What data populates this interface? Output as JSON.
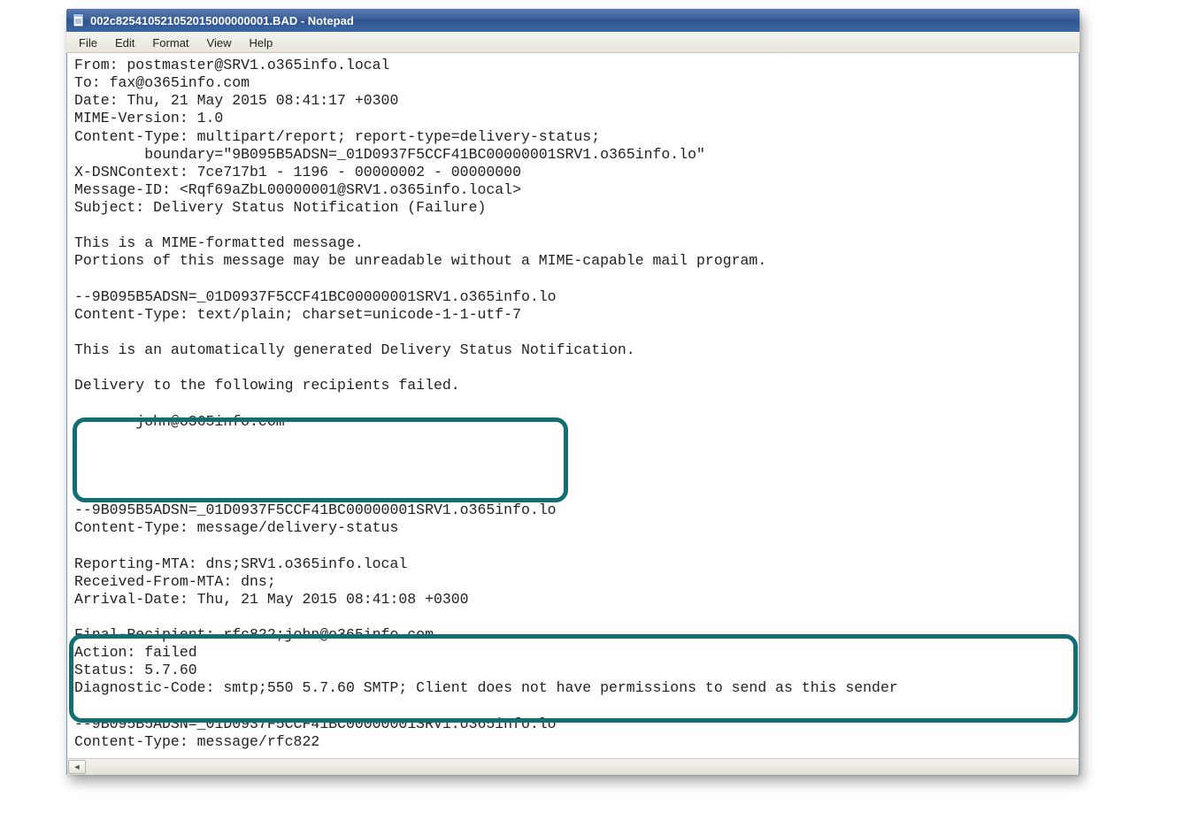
{
  "window": {
    "title": "002c825410521052015000000001.BAD - Notepad"
  },
  "menu": {
    "file": "File",
    "edit": "Edit",
    "format": "Format",
    "view": "View",
    "help": "Help"
  },
  "content": {
    "lines": [
      "From: postmaster@SRV1.o365info.local",
      "To: fax@o365info.com",
      "Date: Thu, 21 May 2015 08:41:17 +0300",
      "MIME-Version: 1.0",
      "Content-Type: multipart/report; report-type=delivery-status;",
      "        boundary=\"9B095B5ADSN=_01D0937F5CCF41BC00000001SRV1.o365info.lo\"",
      "X-DSNContext: 7ce717b1 - 1196 - 00000002 - 00000000",
      "Message-ID: <Rqf69aZbL00000001@SRV1.o365info.local>",
      "Subject: Delivery Status Notification (Failure)",
      "",
      "This is a MIME-formatted message.",
      "Portions of this message may be unreadable without a MIME-capable mail program.",
      "",
      "--9B095B5ADSN=_01D0937F5CCF41BC00000001SRV1.o365info.lo",
      "Content-Type: text/plain; charset=unicode-1-1-utf-7",
      "",
      "This is an automatically generated Delivery Status Notification.",
      "",
      "Delivery to the following recipients failed.",
      "",
      "       john@o365info.com",
      "",
      "",
      "",
      "",
      "--9B095B5ADSN=_01D0937F5CCF41BC00000001SRV1.o365info.lo",
      "Content-Type: message/delivery-status",
      "",
      "Reporting-MTA: dns;SRV1.o365info.local",
      "Received-From-MTA: dns;",
      "Arrival-Date: Thu, 21 May 2015 08:41:08 +0300",
      "",
      "Final-Recipient: rfc822;john@o365info.com",
      "Action: failed",
      "Status: 5.7.60",
      "Diagnostic-Code: smtp;550 5.7.60 SMTP; Client does not have permissions to send as this sender",
      "",
      "--9B095B5ADSN=_01D0937F5CCF41BC00000001SRV1.o365info.lo",
      "Content-Type: message/rfc822",
      ""
    ]
  },
  "highlights": {
    "box1_desc": "Delivery to the following recipients failed / john@o365info.com",
    "box2_desc": "Final-Recipient / Action / Status / Diagnostic-Code block"
  }
}
